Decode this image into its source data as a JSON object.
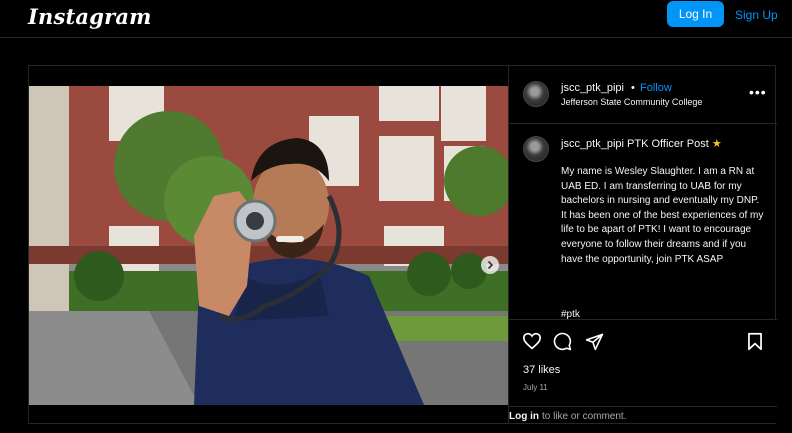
{
  "app": {
    "logo": "Instagram",
    "login_label": "Log In",
    "signup_label": "Sign Up"
  },
  "post": {
    "header": {
      "username": "jscc_ptk_pipi",
      "separator": "•",
      "follow_label": "Follow",
      "location": "Jefferson State Community College",
      "more_label": "•••"
    },
    "caption": {
      "username": "jscc_ptk_pipi",
      "title": "PTK Officer Post",
      "star": "★",
      "body": "My name is Wesley Slaughter. I am a RN at UAB ED. I am transferring to UAB for my bachelors in nursing and eventually my DNP. It has been one of the best experiences of my life to be apart of PTK! I want to encourage everyone to follow their dreams and if you have the opportunity, join PTK ASAP",
      "hashtag": "#ptk"
    },
    "likes": "37 likes",
    "date": "July 11",
    "login_prompt": {
      "link": "Log in",
      "rest": "to like or comment."
    },
    "carousel": {
      "slides": 3,
      "current": 1
    },
    "icons": {
      "like": "heart-icon",
      "comment": "comment-icon",
      "share": "share-icon",
      "save": "bookmark-icon",
      "next": "chevron-right-icon"
    }
  }
}
